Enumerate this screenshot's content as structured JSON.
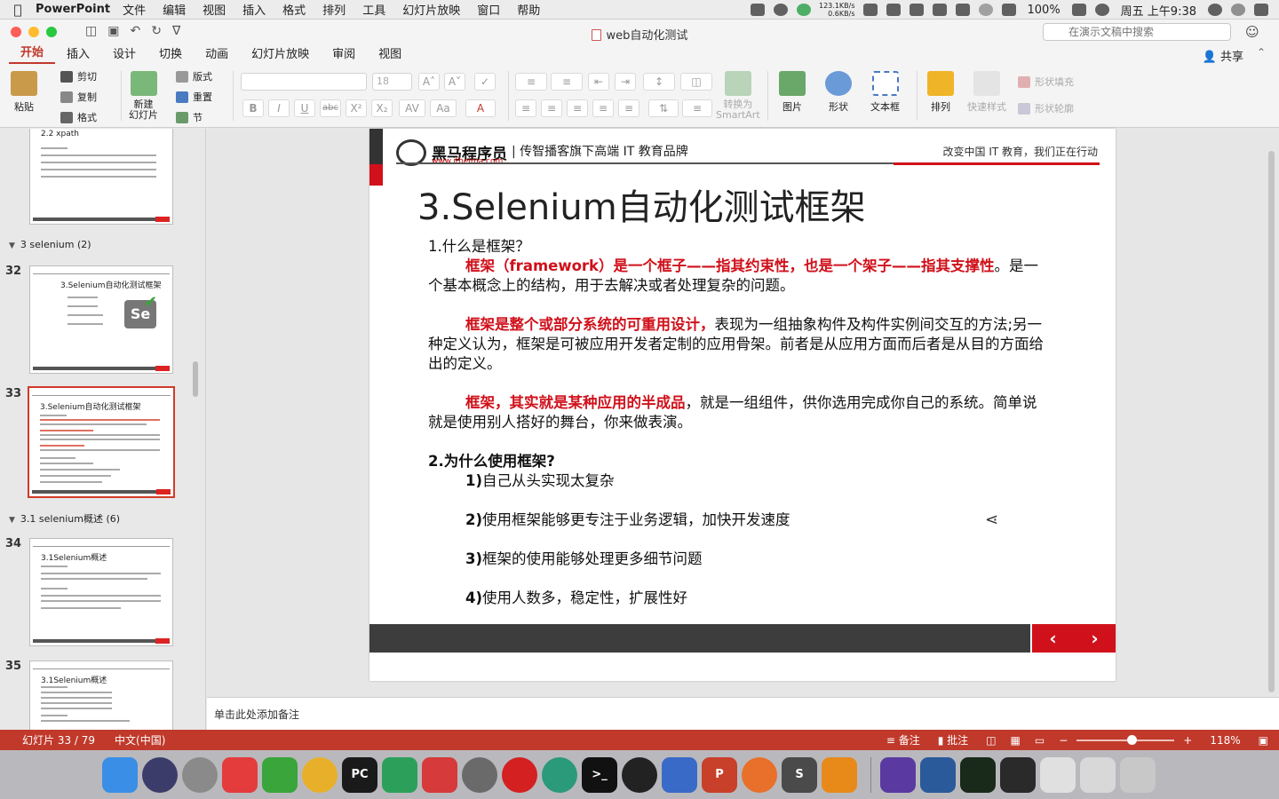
{
  "menubar": {
    "app_name": "PowerPoint",
    "items": [
      "文件",
      "编辑",
      "视图",
      "插入",
      "格式",
      "排列",
      "工具",
      "幻灯片放映",
      "窗口",
      "帮助"
    ],
    "net_up": "123.1KB/s",
    "net_down": "0.6KB/s",
    "battery": "100%",
    "clock": "周五 上午9:38"
  },
  "titlebar": {
    "doc_title": "web自动化测试",
    "search_placeholder": "在演示文稿中搜索"
  },
  "ribbon": {
    "tabs": [
      "开始",
      "插入",
      "设计",
      "切换",
      "动画",
      "幻灯片放映",
      "审阅",
      "视图"
    ],
    "active_tab": "开始",
    "share_label": "共享",
    "paste": "粘贴",
    "cut": "剪切",
    "copy": "复制",
    "format": "格式",
    "new_slide": "新建\n幻灯片",
    "layout": "版式",
    "reset": "重置",
    "section": "节",
    "font_size": "18",
    "convert_smartart": "转换为\nSmartArt",
    "picture": "图片",
    "shape": "形状",
    "textbox": "文本框",
    "arrange": "排列",
    "quick_styles": "快速样式",
    "shape_fill": "形状填充",
    "shape_outline": "形状轮廓"
  },
  "thumbnails": {
    "slide31_title": "2.2 xpath",
    "section_a": "3 selenium (2)",
    "section_b": "3.1 selenium概述 (6)",
    "slides": [
      {
        "num": "32",
        "title": "3.Selenium自动化测试框架",
        "logo": "Se"
      },
      {
        "num": "33",
        "title": "3.Selenium自动化测试框架"
      },
      {
        "num": "34",
        "title": "3.1Selenium概述"
      },
      {
        "num": "35",
        "title": "3.1Selenium概述"
      }
    ]
  },
  "slide": {
    "brand_name": "黑马程序员",
    "brand_url": "www.itheima.com",
    "tagline": "| 传智播客旗下高端 IT 教育品牌",
    "slogan": "改变中国 IT 教育，我们正在行动",
    "title": "3.Selenium自动化测试框架",
    "q1": "1.什么是框架？",
    "p1_red": "框架（framework）是一个框子——指其约束性，也是一个架子——指其支撑性",
    "p1_rest": "。是一个基本概念上的结构，用于去解决或者处理复杂的问题。",
    "p2_red": "框架是整个或部分系统的可重用设计，",
    "p2_rest": "表现为一组抽象构件及构件实例间交互的方法;另一种定义认为，框架是可被应用开发者定制的应用骨架。前者是从应用方面而后者是从目的方面给出的定义。",
    "p3_red": "框架，其实就是某种应用的半成品",
    "p3_rest": "，就是一组组件，供你选用完成你自己的系统。简单说就是使用别人搭好的舞台，你来做表演。",
    "q2": "2.为什么使用框架?",
    "reasons": [
      {
        "num": "1)",
        "text": "自己从头实现太复杂"
      },
      {
        "num": "2)",
        "text": "使用框架能够更专注于业务逻辑，加快开发速度"
      },
      {
        "num": "3)",
        "text": "框架的使用能够处理更多细节问题"
      },
      {
        "num": "4)",
        "text": "使用人数多，稳定性，扩展性好"
      }
    ],
    "nav_prev": "‹",
    "nav_next": "›"
  },
  "notes": {
    "placeholder": "单击此处添加备注"
  },
  "status": {
    "slide_count": "幻灯片 33 / 79",
    "language": "中文(中国)",
    "notes_label": "备注",
    "comments_label": "批注",
    "zoom": "118%",
    "zoom_level": 0.56
  },
  "dock": {
    "apps": [
      "Finder",
      "Siri",
      "Launchpad",
      "XMind",
      "Evernote",
      "Chrome",
      "PyCharm",
      "GitKraken",
      "Git",
      "System Preferences",
      "NetEase Music",
      "Atom",
      "Terminal",
      "OBS",
      "Parallels",
      "PowerPoint",
      "Firefox",
      "Sublime Text",
      "VLC"
    ]
  }
}
